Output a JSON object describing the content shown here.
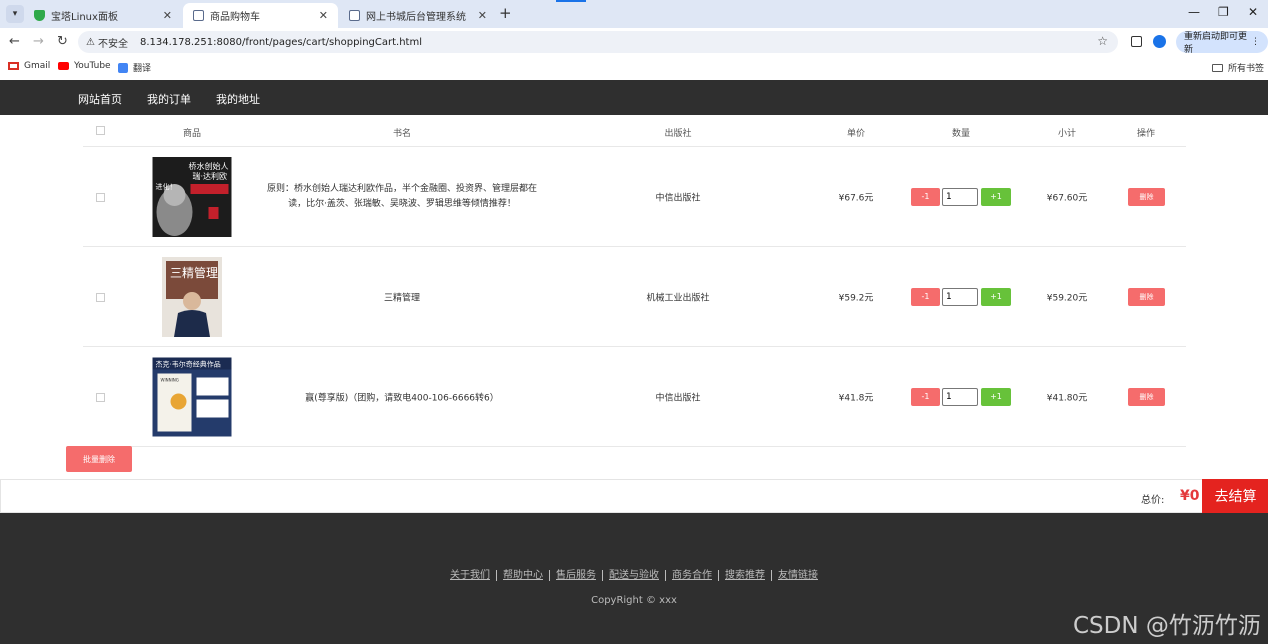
{
  "browser": {
    "tabs": [
      {
        "title": "宝塔Linux面板",
        "active": false
      },
      {
        "title": "商品购物车",
        "active": true
      },
      {
        "title": "网上书城后台管理系统",
        "active": false
      }
    ],
    "new_tab": "+",
    "address": {
      "security_label": "不安全",
      "url": "8.134.178.251:8080/front/pages/cart/shoppingCart.html"
    },
    "relaunch_label": "重新启动即可更新",
    "bookmarks": [
      {
        "label": "Gmail",
        "icon": "gmail-icon"
      },
      {
        "label": "YouTube",
        "icon": "youtube-icon"
      },
      {
        "label": "翻译",
        "icon": "translate-icon"
      }
    ],
    "all_bookmarks": "所有书签"
  },
  "nav": {
    "items": [
      "网站首页",
      "我的订单",
      "我的地址"
    ]
  },
  "cart": {
    "headers": {
      "product": "商品",
      "title": "书名",
      "publisher": "出版社",
      "price": "单价",
      "quantity": "数量",
      "subtotal": "小计",
      "action": "操作"
    },
    "minus_label": "-1",
    "plus_label": "+1",
    "delete_label": "删除",
    "items": [
      {
        "title": "原则：桥水创始人瑞达利欧作品，半个金融圈、投资界、管理层都在读，比尔·盖茨、张瑞敏、吴晓波、罗辑思维等倾情推荐！",
        "cover_text": "桥水创始人 瑞·达利欧",
        "cover_subtext": "进化！",
        "publisher": "中信出版社",
        "price": "¥67.6元",
        "quantity": "1",
        "subtotal": "¥67.60元"
      },
      {
        "title": "三精管理",
        "cover_text": "三精管理",
        "cover_subtext": "",
        "publisher": "机械工业出版社",
        "price": "¥59.2元",
        "quantity": "1",
        "subtotal": "¥59.20元"
      },
      {
        "title": "赢(尊享版)（团购，请致电400-106-6666转6）",
        "cover_text": "杰克·韦尔奇经典作品",
        "cover_subtext": "WINNING",
        "publisher": "中信出版社",
        "price": "¥41.8元",
        "quantity": "1",
        "subtotal": "¥41.80元"
      }
    ],
    "batch_delete_label": "批量删除"
  },
  "summary": {
    "total_label": "总价:",
    "total_value": "¥0",
    "checkout_label": "去结算"
  },
  "footer": {
    "links": [
      "关于我们",
      "帮助中心",
      "售后服务",
      "配送与验收",
      "商务合作",
      "搜索推荐",
      "友情链接"
    ],
    "copyright": "CopyRight © xxx",
    "watermark": "CSDN @竹沥竹沥"
  },
  "colors": {
    "nav_bg": "#2f2f2f",
    "danger": "#f56c6c",
    "success": "#67c23a",
    "checkout": "#e4231f",
    "price_red": "#e4393c"
  }
}
